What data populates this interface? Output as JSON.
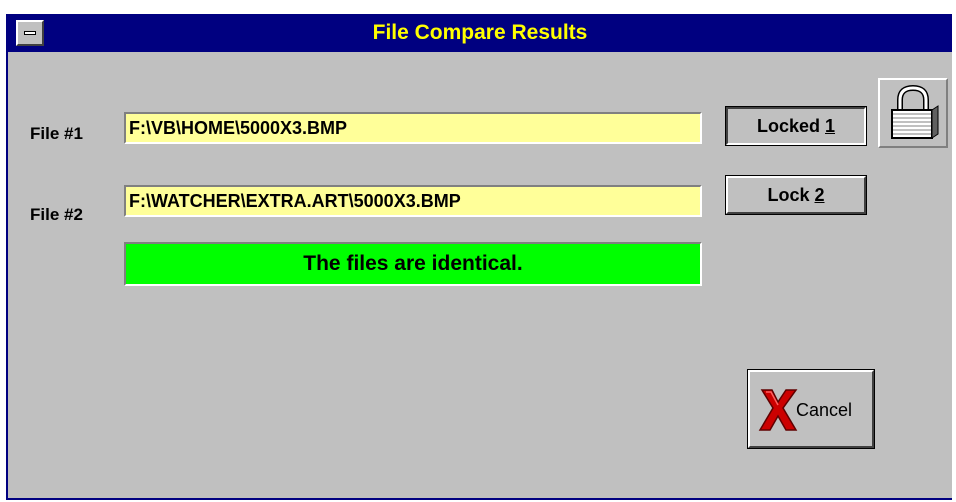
{
  "window": {
    "title": "File Compare Results"
  },
  "file1": {
    "label": "File #1",
    "value": "F:\\VB\\HOME\\5000X3.BMP"
  },
  "file2": {
    "label": "File #2",
    "value": "F:\\WATCHER\\EXTRA.ART\\5000X3.BMP"
  },
  "status": {
    "message": "The files are identical."
  },
  "buttons": {
    "lock1_text": "Locked ",
    "lock1_key": "1",
    "lock2_text": "Lock ",
    "lock2_key": "2",
    "cancel_label": "Cancel"
  },
  "icons": {
    "system_menu": "system-menu-icon",
    "padlock": "padlock-icon",
    "cancel": "red-x-icon"
  },
  "colors": {
    "titlebar": "#000080",
    "title_text": "#ffff00",
    "field_bg": "#ffff99",
    "status_bg": "#00ff00",
    "window_bg": "#c0c0c0",
    "cancel_x": "#cc0000"
  }
}
